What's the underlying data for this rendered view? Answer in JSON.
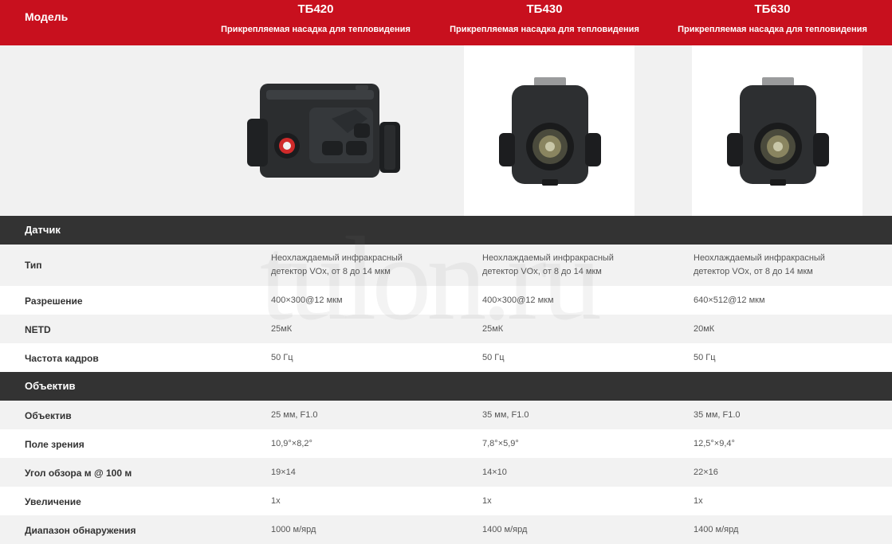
{
  "header": {
    "column_label": "Модель",
    "models": [
      {
        "name": "ТБ420",
        "subtitle": "Прикрепляемая насадка для тепловидения"
      },
      {
        "name": "ТБ430",
        "subtitle": "Прикрепляемая насадка для тепловидения"
      },
      {
        "name": "ТБ630",
        "subtitle": "Прикрепляемая насадка для тепловидения"
      }
    ]
  },
  "images": [
    {
      "icon": "thermal-clip-on-side-view-icon"
    },
    {
      "icon": "thermal-clip-on-front-view-icon"
    },
    {
      "icon": "thermal-clip-on-front-view-icon"
    }
  ],
  "sections": {
    "sensor": "Датчик",
    "lens": "Объектив"
  },
  "rows": {
    "type": {
      "label": "Тип",
      "values": [
        "Неохлаждаемый инфракрасный детектор VOx, от 8 до 14 мкм",
        "Неохлаждаемый инфракрасный детектор VOx, от 8 до 14 мкм",
        "Неохлаждаемый инфракрасный детектор VOx, от 8 до 14 мкм"
      ]
    },
    "resolution": {
      "label": "Разрешение",
      "values": [
        "400×300@12 мкм",
        "400×300@12 мкм",
        "640×512@12 мкм"
      ]
    },
    "netd": {
      "label": "NETD",
      "values": [
        "25мК",
        "25мК",
        "20мК"
      ]
    },
    "framerate": {
      "label": "Частота кадров",
      "values": [
        "50 Гц",
        "50 Гц",
        "50 Гц"
      ]
    },
    "lens": {
      "label": "Объектив",
      "values": [
        "25 мм, F1.0",
        "35 мм, F1.0",
        "35 мм, F1.0"
      ]
    },
    "fov": {
      "label": "Поле зрения",
      "values": [
        "10,9°×8,2°",
        "7,8°×5,9°",
        "12,5°×9,4°"
      ]
    },
    "angle": {
      "label": "Угол обзора м @ 100 м",
      "values": [
        "19×14",
        "14×10",
        "22×16"
      ]
    },
    "zoom": {
      "label": "Увеличение",
      "values": [
        "1x",
        "1x",
        "1x"
      ]
    },
    "detection": {
      "label": "Диапазон обнаружения",
      "values": [
        "1000 м/ярд",
        "1400 м/ярд",
        "1400 м/ярд"
      ]
    }
  },
  "watermark": "tulon.ru",
  "colors": {
    "brand_red": "#c8101e",
    "section_dark": "#333333"
  }
}
